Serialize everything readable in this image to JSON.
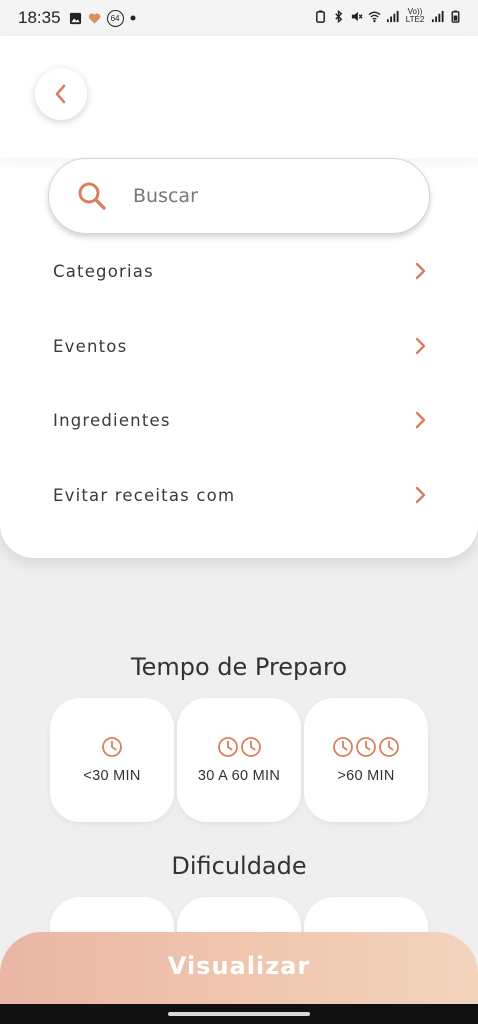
{
  "status_bar": {
    "time": "18:35",
    "badge": "64",
    "network": "Vo)) LTE2"
  },
  "search": {
    "placeholder": "Buscar"
  },
  "filters": [
    {
      "label": "Categorias"
    },
    {
      "label": "Eventos"
    },
    {
      "label": "Ingredientes"
    },
    {
      "label": "Evitar receitas com"
    }
  ],
  "tempo": {
    "title": "Tempo de Preparo",
    "options": [
      {
        "label": "<30 MIN",
        "clocks": 1
      },
      {
        "label": "30 A 60 MIN",
        "clocks": 2
      },
      {
        "label": ">60 MIN",
        "clocks": 3
      }
    ]
  },
  "dificuldade": {
    "title": "Dificuldade"
  },
  "action": {
    "label": "Visualizar"
  },
  "colors": {
    "accent": "#d9805e",
    "button_start": "#eab6a5",
    "button_end": "#f2d4bd"
  },
  "icons": [
    "back-chevron-icon",
    "search-icon",
    "chevron-right-icon",
    "clock-icon"
  ]
}
